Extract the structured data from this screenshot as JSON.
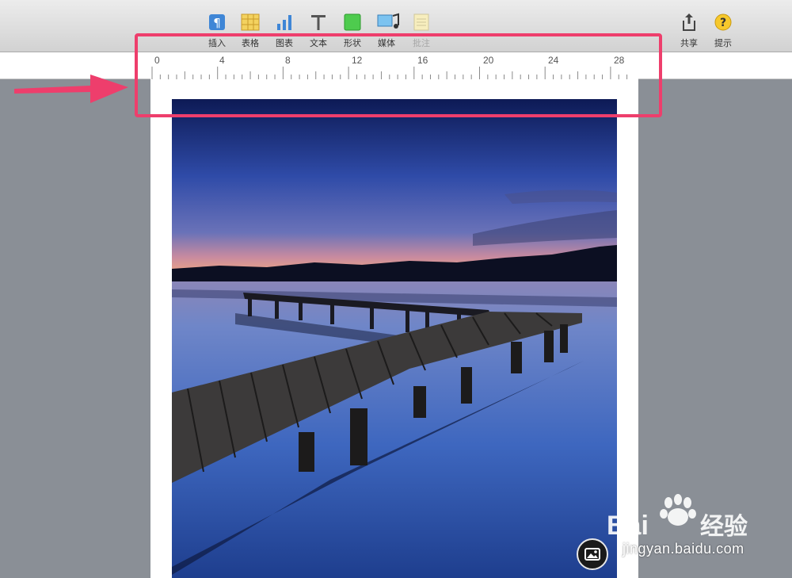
{
  "toolbar": {
    "items": [
      {
        "label": "插入",
        "icon": "paragraph-icon"
      },
      {
        "label": "表格",
        "icon": "table-icon"
      },
      {
        "label": "图表",
        "icon": "chart-icon"
      },
      {
        "label": "文本",
        "icon": "text-icon"
      },
      {
        "label": "形状",
        "icon": "shape-icon"
      },
      {
        "label": "媒体",
        "icon": "media-icon"
      },
      {
        "label": "批注",
        "icon": "comment-icon",
        "disabled": true
      }
    ],
    "share_label": "共享",
    "tips_label": "提示"
  },
  "ruler": {
    "marks": [
      "0",
      "4",
      "8",
      "12",
      "16",
      "20",
      "24",
      "28"
    ]
  },
  "watermark": {
    "brand": "Bai",
    "brand_cn": "经验",
    "url": "jingyan.baidu.com"
  },
  "colors": {
    "annotation": "#ee3e6c",
    "toolbar_bg": "#dcdcdc",
    "canvas_bg": "#8a8f96"
  }
}
